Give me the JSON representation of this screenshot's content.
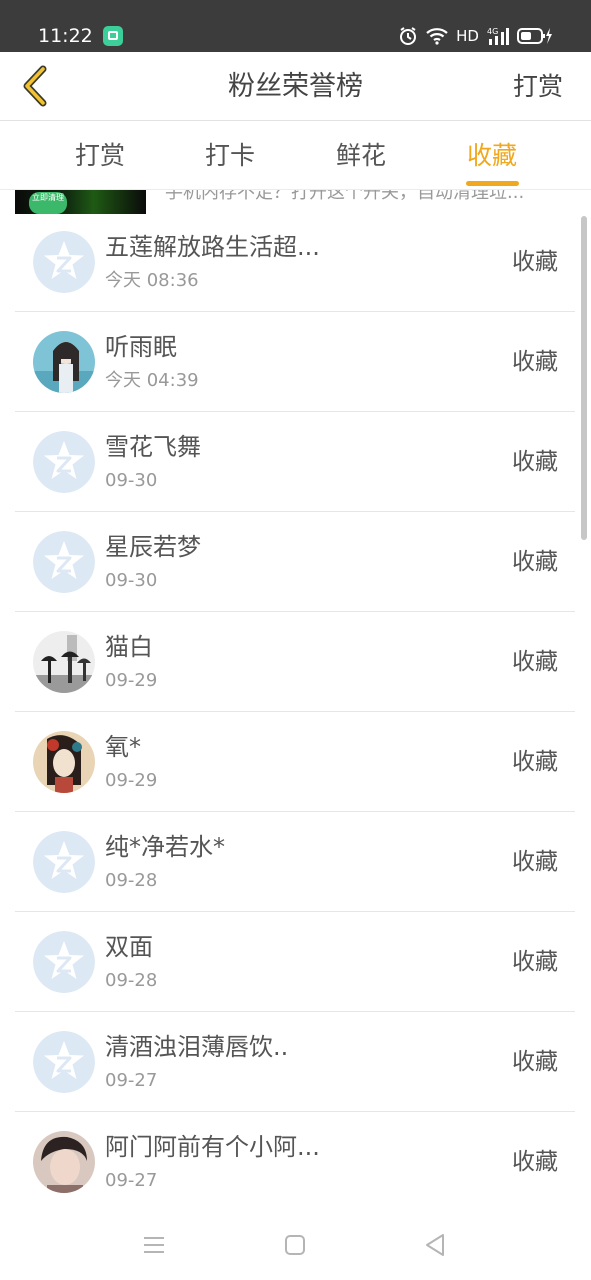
{
  "status_bar": {
    "time": "11:22",
    "network_label": "HD",
    "icons": [
      "app-notification-icon",
      "alarm-icon",
      "wifi-icon",
      "signal-4g-icon",
      "battery-charging-icon"
    ]
  },
  "header": {
    "title": "粉丝荣誉榜",
    "back_icon": "chevron-left-icon",
    "action_label": "打赏"
  },
  "tabs": [
    {
      "label": "打赏",
      "active": false
    },
    {
      "label": "打卡",
      "active": false
    },
    {
      "label": "鲜花",
      "active": false
    },
    {
      "label": "收藏",
      "active": true
    }
  ],
  "ad": {
    "badge": "立即清理",
    "text": "手机内存不足？打开这个开关，自动清理垃..."
  },
  "list": [
    {
      "name": "五莲解放路生活超...",
      "date": "今天 08:36",
      "action": "收藏",
      "avatar": "default-star"
    },
    {
      "name": "听雨眠",
      "date": "今天 04:39",
      "action": "收藏",
      "avatar": "photo-girl-teal"
    },
    {
      "name": "雪花飞舞",
      "date": "09-30",
      "action": "收藏",
      "avatar": "default-star"
    },
    {
      "name": "星辰若梦",
      "date": "09-30",
      "action": "收藏",
      "avatar": "default-star"
    },
    {
      "name": "猫白",
      "date": "09-29",
      "action": "收藏",
      "avatar": "photo-umbrella-figures"
    },
    {
      "name": "氧*",
      "date": "09-29",
      "action": "收藏",
      "avatar": "photo-painted-lady"
    },
    {
      "name": "纯*净若水*",
      "date": "09-28",
      "action": "收藏",
      "avatar": "default-star"
    },
    {
      "name": "双面",
      "date": "09-28",
      "action": "收藏",
      "avatar": "default-star"
    },
    {
      "name": "清酒浊泪薄唇饮..",
      "date": "09-27",
      "action": "收藏",
      "avatar": "default-star"
    },
    {
      "name": "阿门阿前有个小阿...",
      "date": "09-27",
      "action": "收藏",
      "avatar": "photo-young-man"
    }
  ],
  "nav_bar": [
    "menu-icon",
    "home-square-icon",
    "back-triangle-icon"
  ],
  "colors": {
    "accent": "#f0a81e",
    "status_bar": "#3c3c3c",
    "avatar_default": "#dde8f5"
  }
}
